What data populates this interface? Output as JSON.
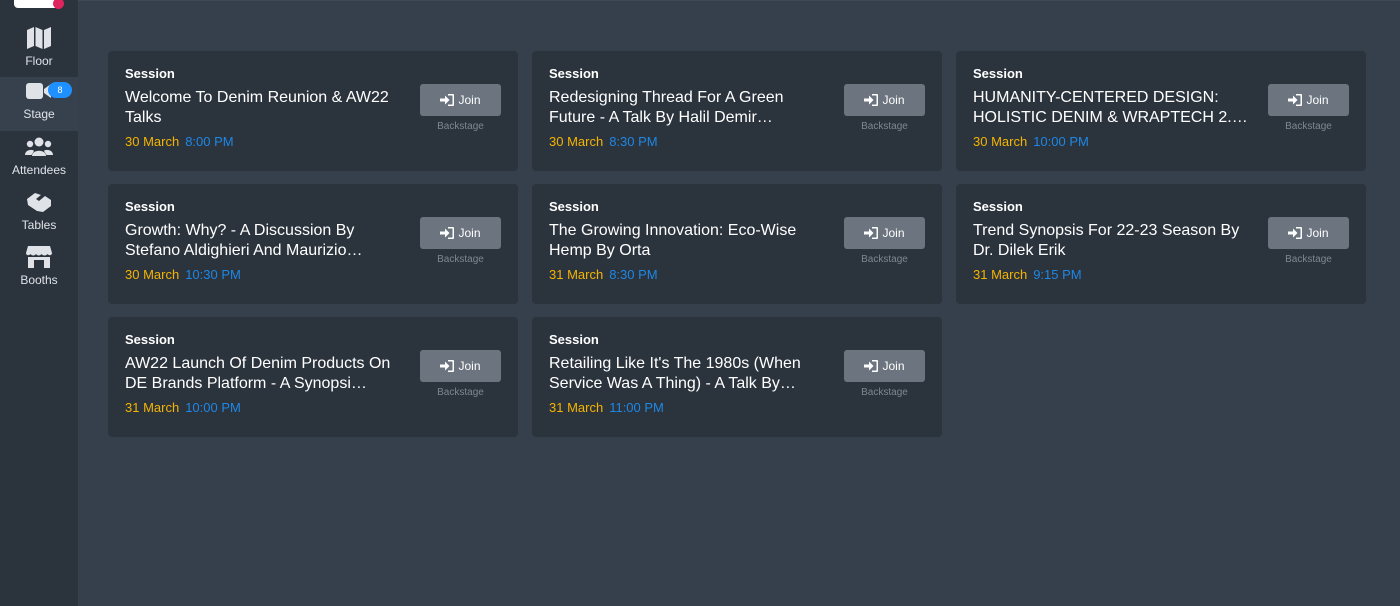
{
  "colors": {
    "accent_date": "#f4b400",
    "accent_time": "#1e88e5",
    "badge": "#1e90ff",
    "logo_dot": "#e0245e"
  },
  "sidebar": {
    "items": [
      {
        "label": "Floor",
        "icon": "map-icon"
      },
      {
        "label": "Stage",
        "icon": "video-camera-icon",
        "badge": "8"
      },
      {
        "label": "Attendees",
        "icon": "users-icon"
      },
      {
        "label": "Tables",
        "icon": "handshake-icon"
      },
      {
        "label": "Booths",
        "icon": "store-icon"
      }
    ]
  },
  "sessions": [
    {
      "type": "Session",
      "title": "Welcome To Denim Reunion & AW22 Talks",
      "date": "30 March",
      "time": "8:00 PM",
      "join_label": "Join",
      "backstage_label": "Backstage"
    },
    {
      "type": "Session",
      "title": "Redesigning Thread For A Green Future - A Talk By Halil Demir…",
      "date": "30 March",
      "time": "8:30 PM",
      "join_label": "Join",
      "backstage_label": "Backstage"
    },
    {
      "type": "Session",
      "title": "HUMANITY-CENTERED DESIGN: HOLISTIC DENIM & WRAPTECH 2.…",
      "date": "30 March",
      "time": "10:00 PM",
      "join_label": "Join",
      "backstage_label": "Backstage"
    },
    {
      "type": "Session",
      "title": "Growth: Why? - A Discussion By Stefano Aldighieri And Maurizio…",
      "date": "30 March",
      "time": "10:30 PM",
      "join_label": "Join",
      "backstage_label": "Backstage"
    },
    {
      "type": "Session",
      "title": "The Growing Innovation: Eco-Wise Hemp By Orta",
      "date": "31 March",
      "time": "8:30 PM",
      "join_label": "Join",
      "backstage_label": "Backstage"
    },
    {
      "type": "Session",
      "title": "Trend Synopsis For 22-23 Season By Dr. Dilek Erik",
      "date": "31 March",
      "time": "9:15 PM",
      "join_label": "Join",
      "backstage_label": "Backstage"
    },
    {
      "type": "Session",
      "title": "AW22 Launch Of Denim Products On DE Brands Platform - A Synopsi…",
      "date": "31 March",
      "time": "10:00 PM",
      "join_label": "Join",
      "backstage_label": "Backstage"
    },
    {
      "type": "Session",
      "title": "Retailing Like It's The 1980s (When Service Was A Thing) - A Talk By…",
      "date": "31 March",
      "time": "11:00 PM",
      "join_label": "Join",
      "backstage_label": "Backstage"
    }
  ]
}
